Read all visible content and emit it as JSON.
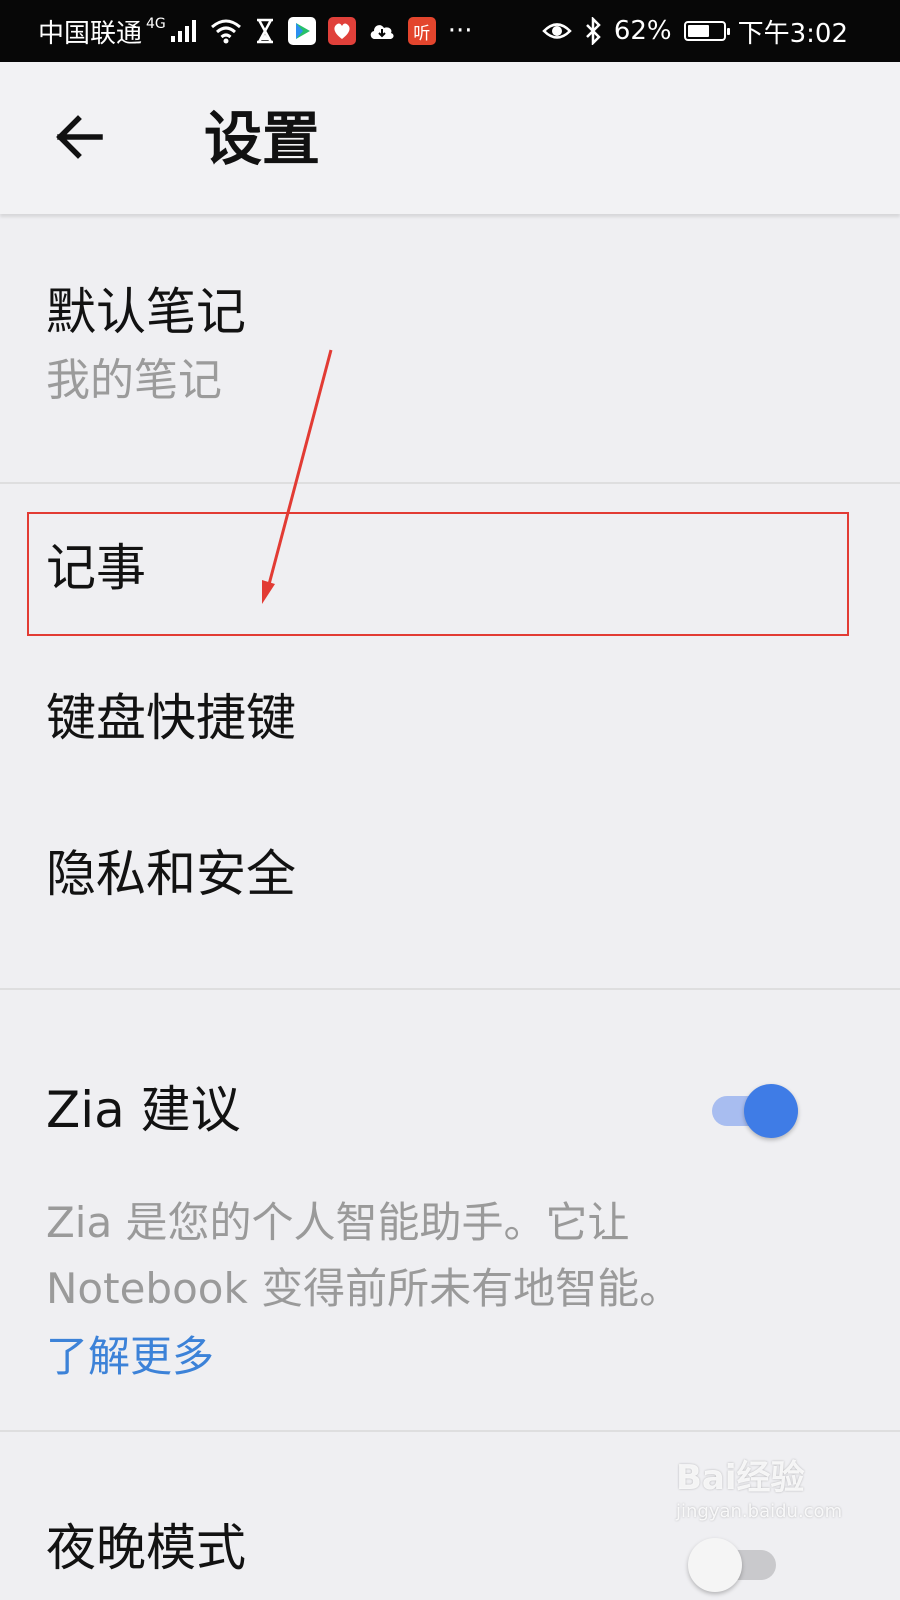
{
  "status_bar": {
    "carrier": "中国联通",
    "network": "4G",
    "app_icons": [
      "hourglass-icon",
      "video-app-icon",
      "taobao-icon",
      "cloud-icon",
      "ting-app-icon"
    ],
    "ting_label": "听",
    "more": "···",
    "battery_pct": "62%",
    "battery_level": 0.62,
    "time": "下午3:02"
  },
  "header": {
    "title": "设置",
    "back_icon": "arrow-left-icon"
  },
  "settings": {
    "default_notebook": {
      "label": "默认笔记",
      "value": "我的笔记"
    },
    "notes": {
      "label": "记事"
    },
    "keyboard_shortcuts": {
      "label": "键盘快捷键"
    },
    "privacy_security": {
      "label": "隐私和安全"
    },
    "zia": {
      "label": "Zia 建议",
      "enabled": true,
      "description_line1": "Zia 是您的个人智能助手。它让",
      "description_line2": "Notebook 变得前所未有地智能。",
      "learn_more": "了解更多"
    },
    "night_mode": {
      "label": "夜晚模式",
      "enabled": false
    }
  },
  "annotation": {
    "box_color": "#e23b34"
  },
  "colors": {
    "accent": "#3f7ce6",
    "link": "#3c82d8"
  },
  "watermark": {
    "main": "Bai经验",
    "sub": "jingyan.baidu.com"
  }
}
